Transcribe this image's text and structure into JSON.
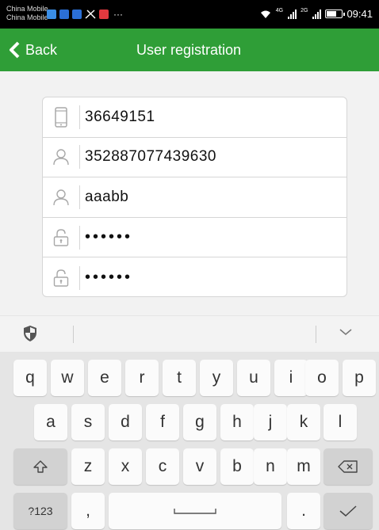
{
  "status_bar": {
    "carrier_1": "China Mobile",
    "carrier_2": "China Mobile",
    "signal_1_tag": "4G",
    "signal_2_tag": "2G",
    "time": "09:41"
  },
  "app_bar": {
    "back_label": "Back",
    "title": "User registration",
    "color": "#2f9e37"
  },
  "form": {
    "phone": "36649151",
    "id_number": "352887077439630",
    "username": "aaabb",
    "password": "••••••",
    "confirm_password": "••••••"
  },
  "keyboard": {
    "row1": [
      "q",
      "w",
      "e",
      "r",
      "t",
      "y",
      "u",
      "i",
      "o",
      "p"
    ],
    "row2": [
      "a",
      "s",
      "d",
      "f",
      "g",
      "h",
      "j",
      "k",
      "l"
    ],
    "row3": [
      "z",
      "x",
      "c",
      "v",
      "b",
      "n",
      "m"
    ],
    "symbols_key": "?123",
    "comma_key": ",",
    "period_key": "."
  }
}
